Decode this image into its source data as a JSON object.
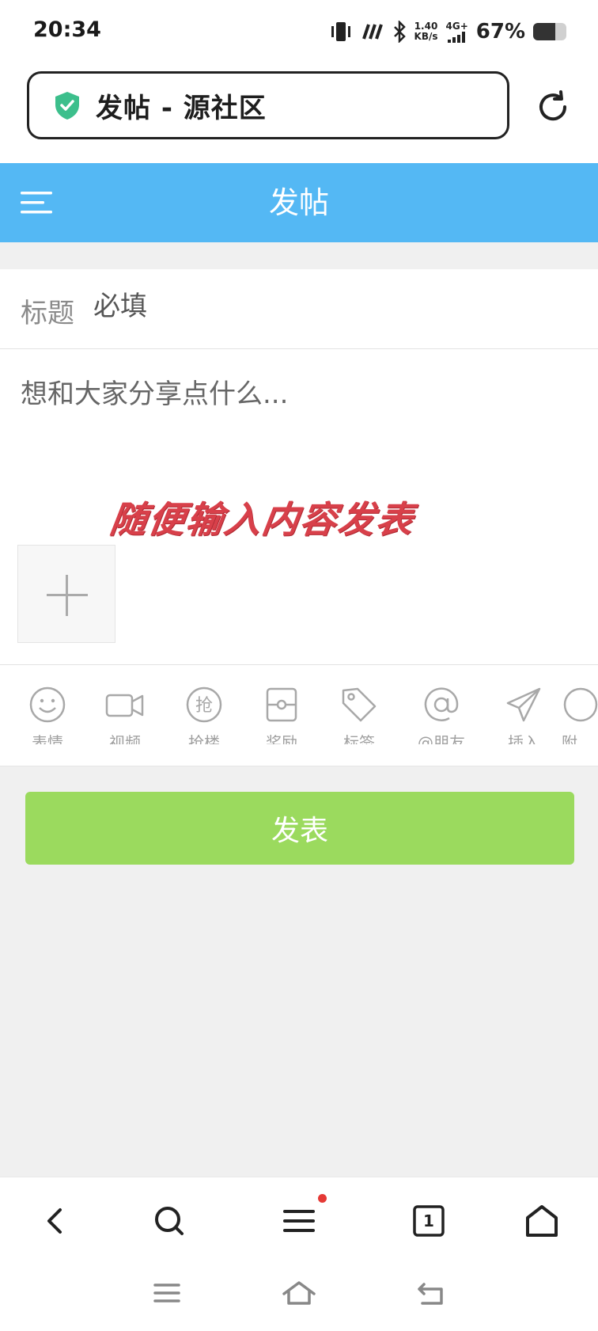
{
  "status_bar": {
    "time": "20:34",
    "network_speed_value": "1.40",
    "network_speed_unit": "KB/s",
    "network_type": "4G+",
    "battery_percent": "67%",
    "battery_level": 0.67,
    "icons": [
      "vibrate-icon",
      "nfc-icon",
      "bluetooth-icon",
      "signal-icon",
      "battery-icon"
    ]
  },
  "address_bar": {
    "page_title": "发帖 - 源社区",
    "secure_icon": "shield-check-icon",
    "shield_color": "#3cbf8c"
  },
  "header": {
    "title": "发帖",
    "background": "#54b8f4"
  },
  "form": {
    "title_label": "标题",
    "title_placeholder": "必填",
    "content_placeholder": "想和大家分享点什么...",
    "overlay_caption": "随便输入内容发表"
  },
  "toolbar": {
    "items": [
      {
        "label": "表情",
        "icon": "smiley-icon"
      },
      {
        "label": "视频",
        "icon": "video-camera-icon"
      },
      {
        "label": "抢楼",
        "icon": "grab-floor-icon"
      },
      {
        "label": "奖励",
        "icon": "reward-icon"
      },
      {
        "label": "标签",
        "icon": "tag-icon"
      },
      {
        "label": "@朋友",
        "icon": "at-icon"
      },
      {
        "label": "插入",
        "icon": "paper-plane-icon"
      },
      {
        "label": "附",
        "icon": "attachment-icon"
      }
    ]
  },
  "publish_button": {
    "label": "发表",
    "color": "#9bda5e"
  },
  "browser_nav": {
    "tab_count": "1",
    "notification_color": "#e53935"
  }
}
